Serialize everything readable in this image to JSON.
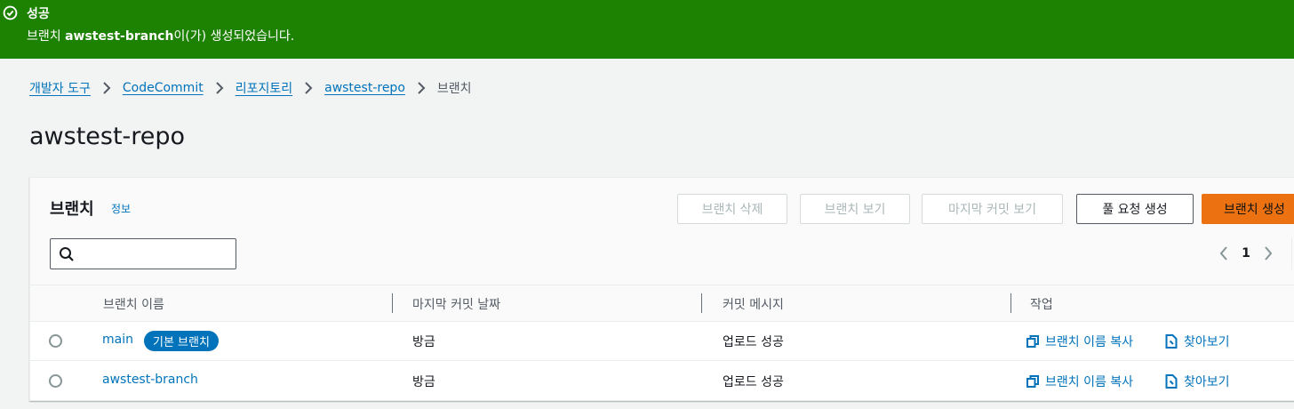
{
  "flash": {
    "title": "성공",
    "message_branch": "awstest-branch",
    "message_prefix": "브랜치 ",
    "message_suffix": "이(가) 생성되었습니다."
  },
  "breadcrumb": {
    "items": [
      "개발자 도구",
      "CodeCommit",
      "리포지토리",
      "awstest-repo"
    ],
    "current": "브랜치"
  },
  "page_title": "awstest-repo",
  "panel": {
    "title": "브랜치",
    "info_link": "정보",
    "buttons": {
      "delete": "브랜치 삭제",
      "view": "브랜치 보기",
      "view_last_commit": "마지막 커밋 보기",
      "pull_request": "풀 요청 생성",
      "create": "브랜치 생성"
    },
    "search": {
      "value": "",
      "placeholder": ""
    },
    "pager": {
      "page": "1"
    }
  },
  "table": {
    "columns": [
      "브랜치 이름",
      "마지막 커밋 날짜",
      "커밋 메시지",
      "작업"
    ],
    "rows": [
      {
        "name": "main",
        "badge": "기본 브랜치",
        "date": "방금",
        "message": "업로드 성공",
        "copy": "브랜치 이름 복사",
        "browse": "찾아보기"
      },
      {
        "name": "awstest-branch",
        "badge": "",
        "date": "방금",
        "message": "업로드 성공",
        "copy": "브랜치 이름 복사",
        "browse": "찾아보기"
      }
    ]
  },
  "colors": {
    "success": "#1d8102",
    "link": "#0073bb",
    "primary": "#ec7211"
  }
}
